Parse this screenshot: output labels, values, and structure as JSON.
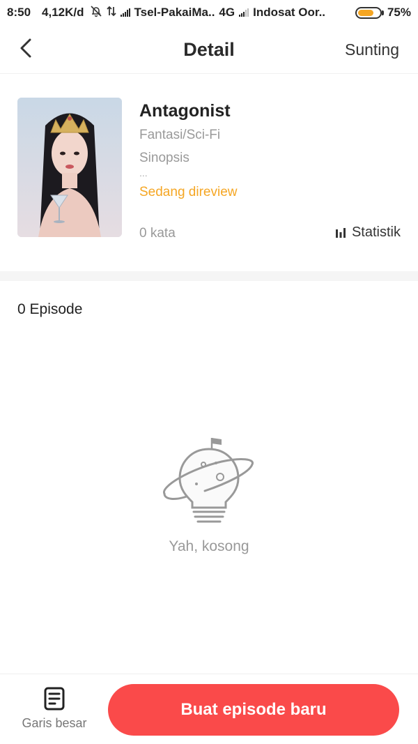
{
  "status_bar": {
    "time": "8:50",
    "speed": "4,12K/d",
    "carrier1": "Tsel-PakaiMa..",
    "network": "4G",
    "carrier2": "Indosat Oor..",
    "battery": "75%",
    "battery_level": 0.75,
    "icons": [
      "mute-icon",
      "data-arrows-icon",
      "signal-icon",
      "signal-icon",
      "battery-icon"
    ]
  },
  "nav": {
    "back_icon": "chevron-left-icon",
    "title": "Detail",
    "edit_label": "Sunting"
  },
  "book": {
    "title": "Antagonist",
    "genre": "Fantasi/Sci-Fi",
    "synopsis_label": "Sinopsis",
    "synopsis_ellipsis": "...",
    "status": "Sedang direview",
    "word_count": "0 kata",
    "stats_label": "Statistik",
    "stats_icon": "bar-chart-icon",
    "cover_icon": "book-cover-image"
  },
  "episodes": {
    "count_label": "0 Episode",
    "empty_text": "Yah, kosong",
    "empty_icon": "lightbulb-planet-icon"
  },
  "bottom_bar": {
    "outline_label": "Garis besar",
    "outline_icon": "document-list-icon",
    "create_label": "Buat episode baru"
  },
  "colors": {
    "accent": "#fa4a4a",
    "status_review": "#f5a623",
    "muted_text": "#999999"
  }
}
